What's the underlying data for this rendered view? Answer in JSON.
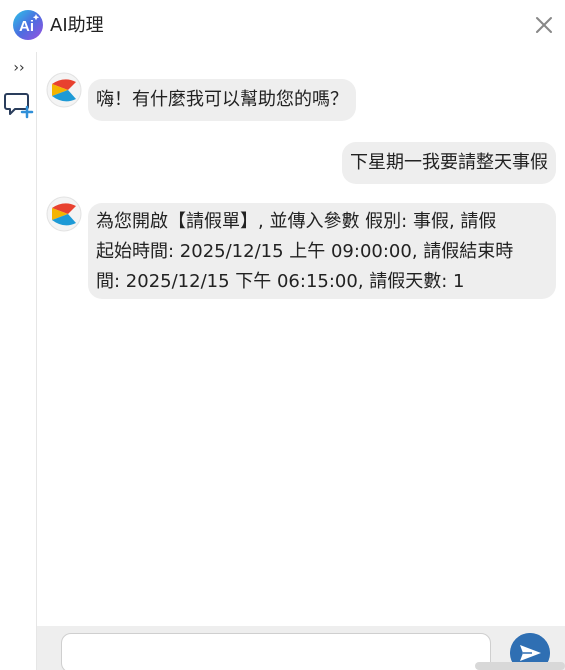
{
  "app": {
    "title": "AI助理",
    "logo_icon": "ai-assistant-logo-icon"
  },
  "header": {
    "close_icon": "close-icon"
  },
  "rail": {
    "expand_label": "››",
    "expand_icon": "chevron-double-right-icon",
    "new_chat_icon": "new-chat-icon"
  },
  "messages": [
    {
      "role": "assistant",
      "text": "嗨！有什麼我可以幫助您的嗎？"
    },
    {
      "role": "user",
      "text": "下星期一我要請整天事假"
    },
    {
      "role": "assistant",
      "lines": [
        "為您開啟【請假單】, 並傳入參數 假別: 事假, 請假",
        "起始時間: 2025/12/15 上午 09:00:00, 請假結束時",
        "間: 2025/12/15 下午 06:15:00, 請假天數: 1"
      ]
    }
  ],
  "input": {
    "value": "",
    "placeholder": ""
  },
  "colors": {
    "accent": "#2f6fb3",
    "bubble": "#eeeeee",
    "input_bar": "#eeeeee"
  }
}
